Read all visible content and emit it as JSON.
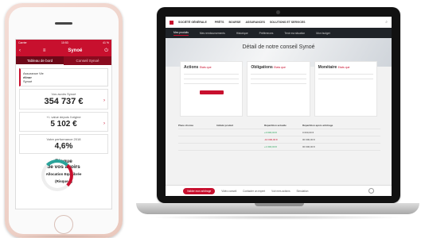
{
  "phone": {
    "status_left": "Carrier",
    "status_time": "10:53",
    "status_right": "41 %",
    "app_title": "Synoé",
    "tabs": [
      "Tableau de bord",
      "Conseil Synoé"
    ],
    "account": {
      "line1": "Assurance Vie",
      "line2": "élinor",
      "line3": "Synoé"
    },
    "cards": [
      {
        "label": "Vos avoirs Synoé",
        "value": "354 737 €"
      },
      {
        "label": "+/- value depuis l'origine",
        "value": "5 102 €"
      },
      {
        "label": "Votre performance 2018",
        "value": "4,6%"
      }
    ],
    "risk": {
      "title_line1": "Risque",
      "title_line2": "de vos avoirs",
      "sub_line1": "Allocation Equilibrée",
      "sub_line2": "(Risque 3)"
    }
  },
  "laptop": {
    "header": {
      "brand": "SOCIÉTÉ GÉNÉRALE",
      "nav": [
        "PRÊTS",
        "BOURSE",
        "ASSURANCES",
        "SOLUTIONS ET SERVICES"
      ]
    },
    "subnav": [
      "Mes produits",
      "Mes remboursements",
      "Historique",
      "Préférences",
      "Tenir ma situation",
      "Mon budget"
    ],
    "hero_title": "Détail de notre conseil Synoé",
    "cards": [
      {
        "title": "Actions",
        "tag": "Etats que"
      },
      {
        "title": "Obligations",
        "tag": "Etats que"
      },
      {
        "title": "Monétaire",
        "tag": "Etats que"
      }
    ],
    "table": {
      "headers": [
        "Place choisie",
        "Intitulé produit",
        "Répartition actuelle",
        "Répartition après arbitrage"
      ],
      "rows": [
        {
          "col2": "+0 000,00 €",
          "col3": "0 000,00 €"
        },
        {
          "col2": "-10 000,00 €",
          "col3": "00 000,00 €"
        },
        {
          "col2": "+1 000,00 €",
          "col3": "00 000,00 €"
        }
      ]
    },
    "footer": {
      "cta": "Valider mon arbitrage",
      "links": [
        "Vidéo conseil",
        "Contacter un expert",
        "Voir mes actions",
        "Simulation"
      ]
    }
  }
}
